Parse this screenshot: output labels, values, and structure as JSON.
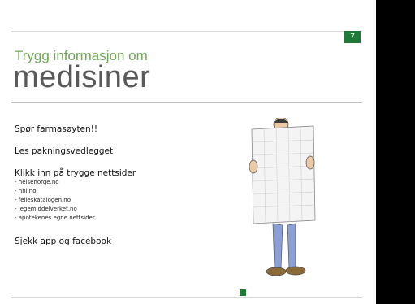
{
  "slide": {
    "page_number": "7",
    "subtitle": "Trygg informasjon om",
    "title": "medisiner",
    "points": {
      "ask": "Spør farmasøyten!!",
      "leaflet": "Les pakningsvedlegget",
      "click": "Klikk inn på trygge nettsider",
      "sites": [
        "- helsenorge.no",
        "- nhi.no",
        "- felleskatalogen.no",
        "- legemiddelverket.no",
        "- apotekenes egne nettsider"
      ],
      "check": "Sjekk app og facebook"
    }
  },
  "colors": {
    "accent_green": "#1e7a36",
    "subtitle_green": "#6aa84f",
    "title_gray": "#595959"
  }
}
